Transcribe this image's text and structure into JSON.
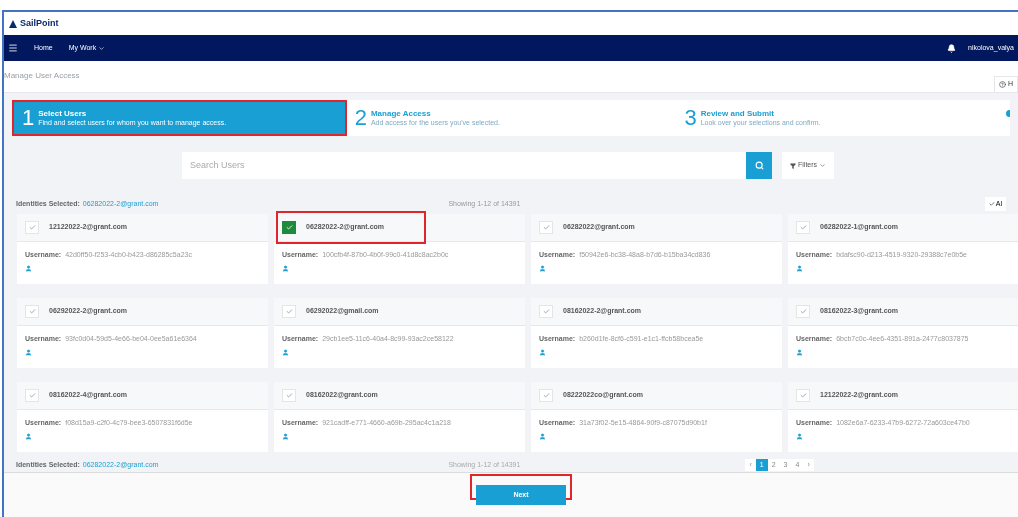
{
  "brand": {
    "name": "SailPoint"
  },
  "nav": {
    "items": [
      {
        "label": "Home",
        "dropdown": false
      },
      {
        "label": "My Work",
        "dropdown": true
      }
    ],
    "user": "nikolova_valya"
  },
  "page": {
    "title": "Manage User Access",
    "help": "H"
  },
  "steps": [
    {
      "number": "1",
      "title": "Select Users",
      "subtitle": "Find and select users for whom you want to manage access.",
      "selected": true
    },
    {
      "number": "2",
      "title": "Manage Access",
      "subtitle": "Add access for the users you've selected.",
      "selected": false
    },
    {
      "number": "3",
      "title": "Review and Submit",
      "subtitle": "Look over your selections and confirm.",
      "selected": false
    }
  ],
  "search": {
    "placeholder": "Search Users",
    "filters": "Filters"
  },
  "summary_top": {
    "label": "Identities Selected:",
    "link": "06282022-2@grant.com",
    "showing": "Showing 1-12 of 14391",
    "select_all": "Al"
  },
  "users": [
    {
      "email": "12122022-2@grant.com",
      "username_label": "Username:",
      "username": "42d0ff50-f253-4cb0-b423-d86285c5a23c",
      "selected": false
    },
    {
      "email": "06282022-2@grant.com",
      "username_label": "Username:",
      "username": "100cfb4f-87b0-4b0f-99c0-41d8c8ac2b0c",
      "selected": true
    },
    {
      "email": "06282022@grant.com",
      "username_label": "Username:",
      "username": "f50942e6-bc38-48a8-b7d6-b15ba34cd836",
      "selected": false
    },
    {
      "email": "06282022-1@grant.com",
      "username_label": "Username:",
      "username": "bdafsc90-d213-4519-9320-29388c7e0b5e",
      "selected": false
    },
    {
      "email": "06292022-2@grant.com",
      "username_label": "Username:",
      "username": "93fc0d04-59d5-4e66-be04-0ee5a61e6364",
      "selected": false
    },
    {
      "email": "06292022@gmail.com",
      "username_label": "Username:",
      "username": "29cb1ee5-11c6-40a4-8c99-93ac2ce58122",
      "selected": false
    },
    {
      "email": "08162022-2@grant.com",
      "username_label": "Username:",
      "username": "b260d1fe-8cf6-c591-e1c1-ffcb58bcea5e",
      "selected": false
    },
    {
      "email": "08162022-3@grant.com",
      "username_label": "Username:",
      "username": "6bcb7c0c-4ee6-4351-891a-2477c8037875",
      "selected": false
    },
    {
      "email": "08162022-4@grant.com",
      "username_label": "Username:",
      "username": "f08d15a9-c2f0-4c79-bee3-6507831f6d5e",
      "selected": false
    },
    {
      "email": "08162022@grant.com",
      "username_label": "Username:",
      "username": "921cadff-e771-4660-a69b-295ac4c1a218",
      "selected": false
    },
    {
      "email": "08222022co@grant.com",
      "username_label": "Username:",
      "username": "31a73f02-5e15-4864-90f9-c87075d90b1f",
      "selected": false
    },
    {
      "email": "12122022-2@grant.com",
      "username_label": "Username:",
      "username": "1082e6a7-6233-47b9-6272-72a603ce47b0",
      "selected": false
    }
  ],
  "summary_bottom": {
    "label": "Identities Selected:",
    "link": "06282022-2@grant.com",
    "showing": "Showing 1-12 of 14391"
  },
  "pagination": [
    {
      "label": "‹",
      "selected": false
    },
    {
      "label": "1",
      "selected": true
    },
    {
      "label": "2",
      "selected": false
    },
    {
      "label": "3",
      "selected": false
    },
    {
      "label": "4",
      "selected": false
    },
    {
      "label": "›",
      "selected": false
    }
  ],
  "next_button": "Next"
}
